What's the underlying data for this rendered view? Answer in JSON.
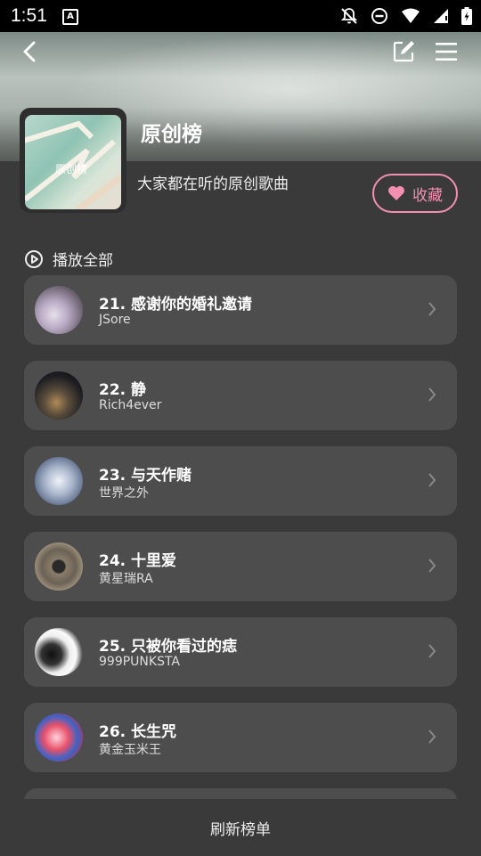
{
  "status": {
    "time": "1:51"
  },
  "header": {
    "title": "原创榜",
    "subtitle": "大家都在听的原创歌曲",
    "cover_text": "原创榜",
    "favorite_label": "收藏",
    "play_all_label": "播放全部"
  },
  "songs": [
    {
      "title": "21. 感谢你的婚礼邀请",
      "artist": "JSore"
    },
    {
      "title": "22. 静",
      "artist": "Rich4ever"
    },
    {
      "title": "23. 与天作赌",
      "artist": "世界之外"
    },
    {
      "title": "24. 十里爱",
      "artist": "黄星瑞RA"
    },
    {
      "title": "25. 只被你看过的痣",
      "artist": "999PUNKSTA"
    },
    {
      "title": "26. 长生咒",
      "artist": "黄金玉米王"
    }
  ],
  "footer": {
    "refresh_label": "刷新榜单"
  },
  "colors": {
    "accent": "#f48fb1",
    "background": "#3a3a3a",
    "card": "#4d4d4d"
  }
}
